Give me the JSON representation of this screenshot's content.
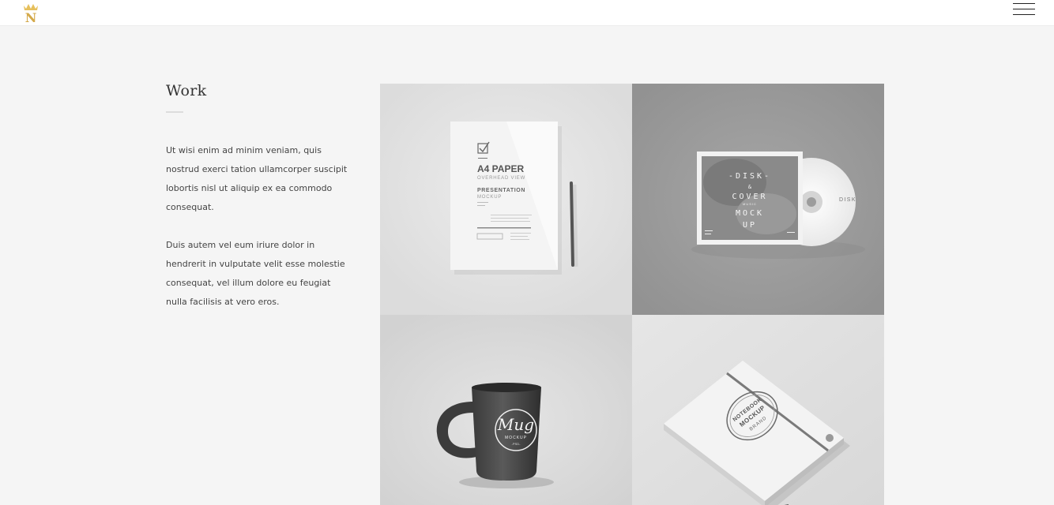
{
  "header": {
    "logo_letter": "N",
    "menu_icon": "hamburger-menu-icon"
  },
  "intro": {
    "title": "Work",
    "paragraphs": [
      "Ut wisi enim ad minim veniam, quis nostrud exerci tation ullamcorper suscipit lobortis nisl ut aliquip ex ea commodo consequat.",
      "Duis autem vel eum iriure dolor in hendrerit in vulputate velit esse molestie consequat, vel illum dolore eu feugiat nulla facilisis at vero eros."
    ]
  },
  "portfolio": {
    "items": [
      {
        "title": "A4 PAPER",
        "subtitle": "OVERHEAD VIEW",
        "label": "PRESENTATION",
        "sublabel": "MOCKUP"
      },
      {
        "cover_lines": [
          "-DISK-",
          "&",
          "COVER",
          "MOCK",
          "UP"
        ],
        "disc_label": "DISK",
        "cover_small": "MUSIC"
      },
      {
        "mug_text": "Mug",
        "mug_sub": "MOCKUP",
        "mug_format": "-PSD-"
      },
      {
        "badge_top": "NOTEBOOK",
        "badge_mid": "MOCKUP",
        "badge_bottom": "BRAND"
      }
    ]
  },
  "colors": {
    "background": "#f5f5f5",
    "header_bg": "#ffffff",
    "logo_gold": "#d4a94a",
    "text": "#444444"
  }
}
